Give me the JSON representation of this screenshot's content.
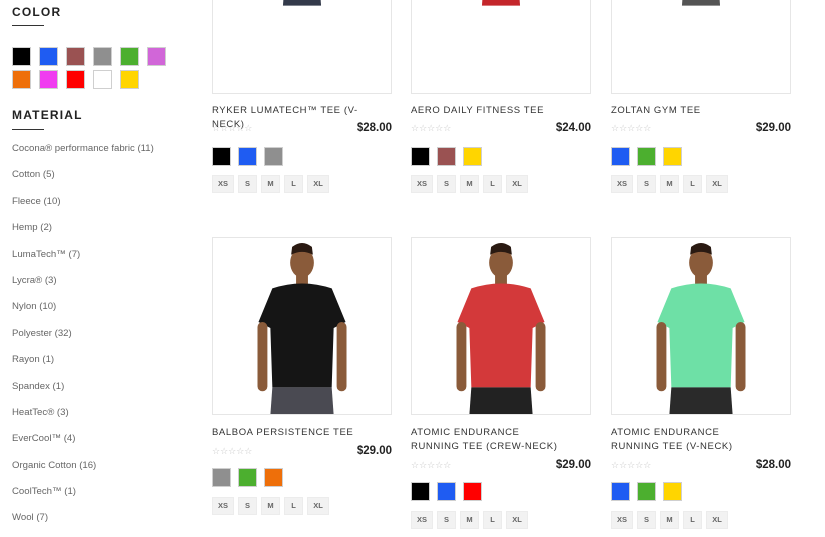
{
  "sidebar": {
    "color_title": "COLOR",
    "material_title": "MATERIAL",
    "colors": [
      "#000000",
      "#1f5cf2",
      "#9a5252",
      "#8f8f8f",
      "#4caf2f",
      "#d166d8",
      "#ee6f0a",
      "#f03cf0",
      "#ff0000",
      "#ffffff",
      "#ffd500"
    ],
    "materials": [
      "Cocona® performance fabric (11)",
      "Cotton (5)",
      "Fleece (10)",
      "Hemp (2)",
      "LumaTech™ (7)",
      "Lycra® (3)",
      "Nylon (10)",
      "Polyester (32)",
      "Rayon (1)",
      "Spandex (1)",
      "HeatTec® (3)",
      "EverCool™ (4)",
      "Organic Cotton (16)",
      "CoolTech™ (1)",
      "Wool (7)"
    ]
  },
  "products": [
    {
      "name": "RYKER LUMATECH™ TEE (V-NECK)",
      "price": "$28.00",
      "rating": "☆☆☆☆☆",
      "shirt": "#e3e3e3",
      "shorts": "#333a4a",
      "skin": "#8a5b3a",
      "swatches": [
        "#000000",
        "#1f5cf2",
        "#8f8f8f"
      ],
      "sizes": [
        "XS",
        "S",
        "M",
        "L",
        "XL"
      ]
    },
    {
      "name": "AERO DAILY FITNESS TEE",
      "price": "$24.00",
      "rating": "☆☆☆☆☆",
      "shirt": "#1d2340",
      "shorts": "#c4262b",
      "skin": "#8a5b3a",
      "swatches": [
        "#000000",
        "#9a5252",
        "#ffd500"
      ],
      "sizes": [
        "XS",
        "S",
        "M",
        "L",
        "XL"
      ]
    },
    {
      "name": "ZOLTAN GYM TEE",
      "price": "$29.00",
      "rating": "☆☆☆☆☆",
      "shirt": "#44a6f2",
      "shorts": "#545454",
      "skin": "#8a5b3a",
      "swatches": [
        "#1f5cf2",
        "#4caf2f",
        "#ffd500"
      ],
      "sizes": [
        "XS",
        "S",
        "M",
        "L",
        "XL"
      ]
    },
    {
      "name": "BALBOA PERSISTENCE TEE",
      "price": "$29.00",
      "rating": "☆☆☆☆☆",
      "shirt": "#151515",
      "shorts": "#4a4a52",
      "skin": "#8a5b3a",
      "swatches": [
        "#8f8f8f",
        "#4caf2f",
        "#ee6f0a"
      ],
      "sizes": [
        "XS",
        "S",
        "M",
        "L",
        "XL"
      ]
    },
    {
      "name": "ATOMIC ENDURANCE RUNNING TEE (CREW-NECK)",
      "price": "$29.00",
      "rating": "☆☆☆☆☆",
      "shirt": "#d3393a",
      "shorts": "#222222",
      "skin": "#8a5b3a",
      "swatches": [
        "#000000",
        "#1f5cf2",
        "#ff0000"
      ],
      "sizes": [
        "XS",
        "S",
        "M",
        "L",
        "XL"
      ]
    },
    {
      "name": "ATOMIC ENDURANCE RUNNING TEE (V-NECK)",
      "price": "$28.00",
      "rating": "☆☆☆☆☆",
      "shirt": "#6ee0a6",
      "shorts": "#2a2a2a",
      "skin": "#8a5b3a",
      "swatches": [
        "#1f5cf2",
        "#4caf2f",
        "#ffd500"
      ],
      "sizes": [
        "XS",
        "S",
        "M",
        "L",
        "XL"
      ]
    }
  ]
}
